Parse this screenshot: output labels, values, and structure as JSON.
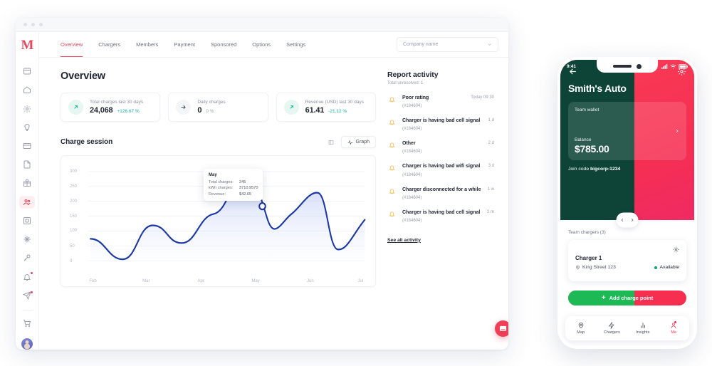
{
  "desktop": {
    "logo": "M",
    "tabs": [
      {
        "label": "Overview",
        "active": true
      },
      {
        "label": "Chargers",
        "active": false
      },
      {
        "label": "Members",
        "active": false
      },
      {
        "label": "Payment",
        "active": false
      },
      {
        "label": "Sponsored",
        "active": false
      },
      {
        "label": "Options",
        "active": false
      },
      {
        "label": "Settings",
        "active": false
      }
    ],
    "company_select": {
      "value": "Company name",
      "icon": "chevron-down-icon"
    },
    "page_title": "Overview",
    "sidebar_icons": [
      "browser-icon",
      "home-icon",
      "settings-icon",
      "lightbulb-icon",
      "card-icon",
      "document-icon",
      "gift-icon",
      "users-icon",
      "grid-icon",
      "sparkle-icon",
      "key-icon",
      "bell-icon",
      "send-icon",
      "cart-icon"
    ],
    "stats": [
      {
        "label": "Total charges last 30 days",
        "value": "24,068",
        "delta": "+126.67 %",
        "trend": "up",
        "icon": "arrow-up-right-icon"
      },
      {
        "label": "Daily charges",
        "value": "0",
        "delta": "0 %",
        "trend": "flat",
        "icon": "arrow-right-icon"
      },
      {
        "label": "Revenue (USD) last 30 days",
        "value": "61.41",
        "delta": "-21.12 %",
        "trend": "up",
        "icon": "arrow-up-right-icon"
      }
    ],
    "chart_section": {
      "title": "Charge session",
      "toggle_table_icon": "table-view-icon",
      "toggle_graph_label": "Graph",
      "toggle_graph_icon": "activity-icon"
    },
    "tooltip": {
      "title": "May",
      "rows": [
        {
          "key": "Total charges:",
          "value": "245"
        },
        {
          "key": "kWh charges:",
          "value": "3710.9570"
        },
        {
          "key": "Revenue:",
          "value": "$42.65"
        }
      ]
    },
    "report": {
      "title": "Report activity",
      "subtitle": "Total unresolved: 1",
      "see_all": "See all activity",
      "items": [
        {
          "name": "Poor rating",
          "id": "(#184604)",
          "time": "Today 09:30",
          "icon": "bell-alert-icon"
        },
        {
          "name": "Charger is having bad cell signal",
          "id": "(#184604)",
          "time": "1 d",
          "icon": "bell-alert-icon"
        },
        {
          "name": "Other",
          "id": "(#184604)",
          "time": "2 d",
          "icon": "bell-alert-icon"
        },
        {
          "name": "Charger is having bad wifi signal",
          "id": "(#184604)",
          "time": "3 d",
          "icon": "bell-alert-icon"
        },
        {
          "name": "Charger disconnected for a while",
          "id": "(#184604)",
          "time": "1 w",
          "icon": "bell-alert-icon"
        },
        {
          "name": "Charger is having bad cell signal",
          "id": "(#184604)",
          "time": "2 m",
          "icon": "bell-alert-icon"
        }
      ]
    },
    "chat_icon": "chat-bubble-icon"
  },
  "phone": {
    "status": {
      "time": "9:41",
      "signal_icon": "signal-icon",
      "wifi_icon": "wifi-icon",
      "battery_icon": "battery-icon"
    },
    "back_icon": "arrow-left-icon",
    "gear_icon": "gear-icon",
    "title": "Smith's Auto",
    "wallet": {
      "label": "Team wallet",
      "balance_label": "Balance",
      "balance": "$785.00",
      "arrow_icon": "chevron-right-icon"
    },
    "join_code_prefix": "Join code ",
    "join_code": "bigcorp-1234",
    "carousel": {
      "prev_icon": "chevron-left-icon",
      "next_icon": "chevron-right-icon"
    },
    "chargers_label": "Team chargers (3)",
    "charger": {
      "name": "Charger 1",
      "address": "King Street 123",
      "address_icon": "pin-icon",
      "status": "Available",
      "gear_icon": "gear-icon"
    },
    "add_button": {
      "label": "Add charge point",
      "icon": "plus-icon"
    },
    "tabbar": [
      {
        "label": "Map",
        "icon": "pin-icon",
        "active": false
      },
      {
        "label": "Chargers",
        "icon": "bolt-icon",
        "active": false
      },
      {
        "label": "Insights",
        "icon": "bars-icon",
        "active": false
      },
      {
        "label": "Me",
        "icon": "person-icon",
        "active": true
      }
    ]
  },
  "colors": {
    "accent_red": "#e8485f",
    "phone_red": "#f62f51",
    "green_dark": "#0d4437",
    "teal": "#17b392",
    "chart_line": "#1b37a8",
    "warn": "#f0b429"
  },
  "chart_data": {
    "type": "area",
    "title": "Charge session",
    "xlabel": "",
    "ylabel": "",
    "ylim": [
      0,
      300
    ],
    "yticks": [
      0,
      50,
      100,
      150,
      200,
      250,
      300
    ],
    "xticks": [
      "Feb",
      "Mar",
      "Apr",
      "May",
      "Jun",
      "Jul"
    ],
    "grid": true,
    "legend": "none",
    "series": [
      {
        "name": "Charge sessions",
        "x": [
          0,
          0.5,
          1.0,
          1.55,
          2.0,
          2.5,
          2.95,
          3.25,
          3.6,
          3.95,
          4.35,
          4.8,
          5.0
        ],
        "values": [
          72,
          25,
          113,
          62,
          145,
          250,
          215,
          135,
          190,
          170,
          52,
          95,
          138
        ]
      }
    ],
    "highlight_point": {
      "x": "May",
      "y": 215,
      "label": "May"
    },
    "annotations": {
      "tooltip_title": "May",
      "total_charges": 245,
      "kwh_charges": 3710.957,
      "revenue_usd": 42.65
    }
  }
}
